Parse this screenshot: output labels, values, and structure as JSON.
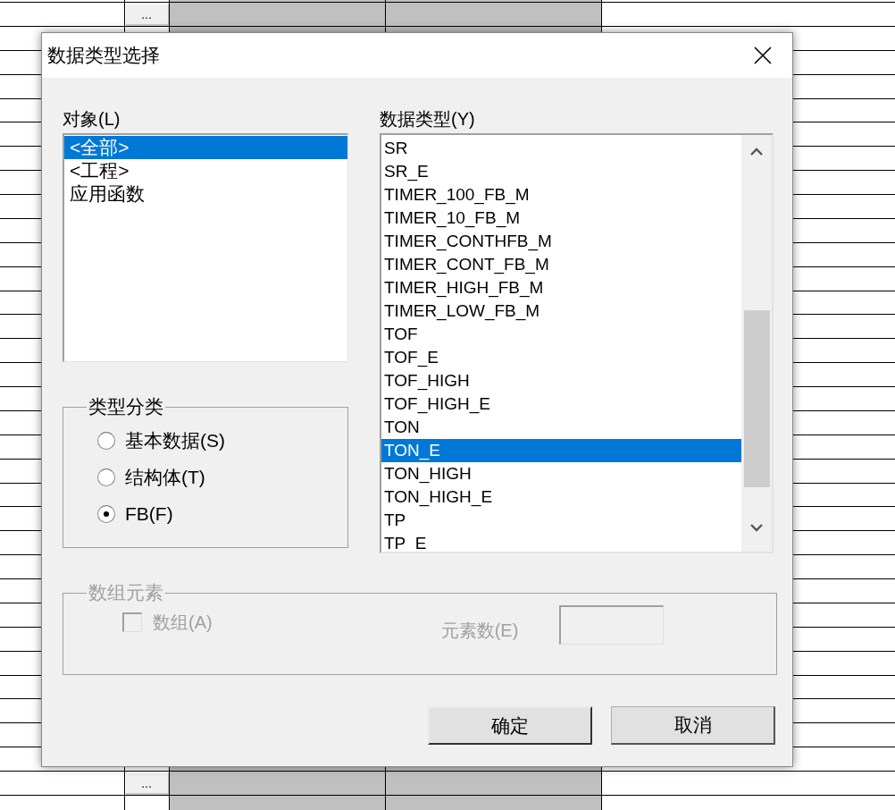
{
  "background": {
    "grid_buttons": [
      "...",
      "..."
    ]
  },
  "window": {
    "title": "数据类型选择"
  },
  "object_list": {
    "label": "对象(L)",
    "items": [
      {
        "text": "<全部>",
        "selected": true
      },
      {
        "text": "<工程>",
        "selected": false
      },
      {
        "text": "应用函数",
        "selected": false
      }
    ]
  },
  "category": {
    "label": "类型分类",
    "options": [
      {
        "label": "基本数据(S)",
        "selected": false
      },
      {
        "label": "结构体(T)",
        "selected": false
      },
      {
        "label": "FB(F)",
        "selected": true
      }
    ]
  },
  "type_list": {
    "label": "数据类型(Y)",
    "items": [
      {
        "text": "SR",
        "selected": false
      },
      {
        "text": "SR_E",
        "selected": false
      },
      {
        "text": "TIMER_100_FB_M",
        "selected": false
      },
      {
        "text": "TIMER_10_FB_M",
        "selected": false
      },
      {
        "text": "TIMER_CONTHFB_M",
        "selected": false
      },
      {
        "text": "TIMER_CONT_FB_M",
        "selected": false
      },
      {
        "text": "TIMER_HIGH_FB_M",
        "selected": false
      },
      {
        "text": "TIMER_LOW_FB_M",
        "selected": false
      },
      {
        "text": "TOF",
        "selected": false
      },
      {
        "text": "TOF_E",
        "selected": false
      },
      {
        "text": "TOF_HIGH",
        "selected": false
      },
      {
        "text": "TOF_HIGH_E",
        "selected": false
      },
      {
        "text": "TON",
        "selected": false
      },
      {
        "text": "TON_E",
        "selected": true
      },
      {
        "text": "TON_HIGH",
        "selected": false
      },
      {
        "text": "TON_HIGH_E",
        "selected": false
      },
      {
        "text": "TP",
        "selected": false
      },
      {
        "text": "TP_E",
        "selected": false
      }
    ]
  },
  "array": {
    "label": "数组元素",
    "disabled": true,
    "checkbox": {
      "label": "数组(A)",
      "checked": false
    },
    "count_label": "元素数(E)"
  },
  "buttons": [
    {
      "label": "确定",
      "default": true
    },
    {
      "label": "取消",
      "default": false
    }
  ]
}
